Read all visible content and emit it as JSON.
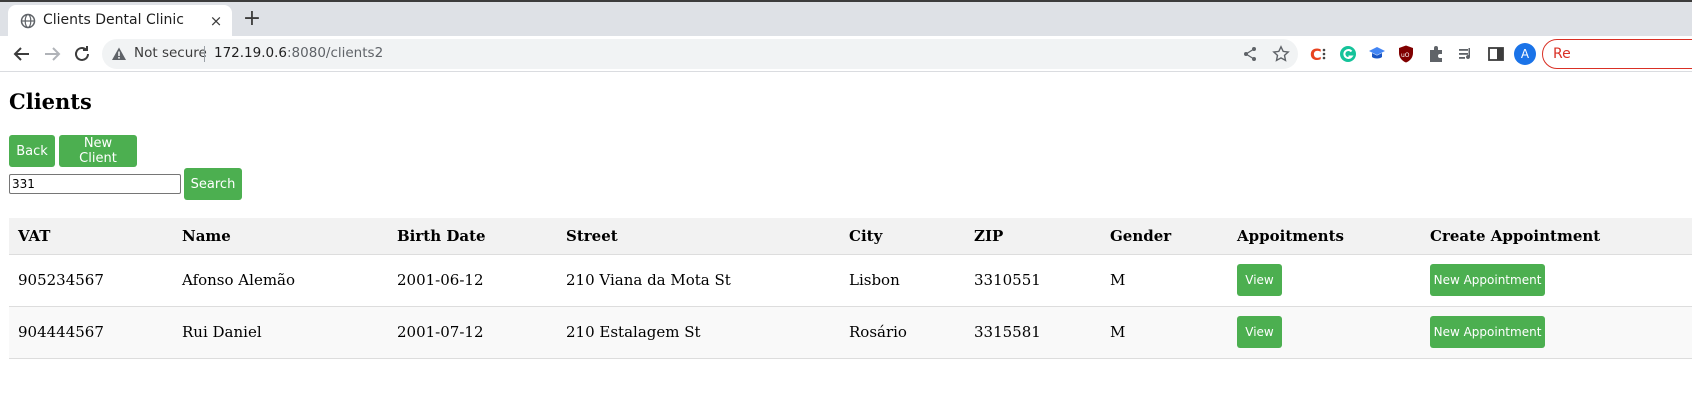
{
  "browser": {
    "tab_title": "Clients Dental Clinic",
    "tab_close": "×",
    "new_tab": "+",
    "not_secure": "Not secure",
    "url_host": "172.19.0.6",
    "url_rest": ":8080/clients2",
    "profile_initial": "A",
    "relaunch_label": "Re"
  },
  "page": {
    "title": "Clients",
    "back_label": "Back",
    "new_client_label": "New Client",
    "search_value": "331",
    "search_label": "Search"
  },
  "table": {
    "headers": [
      "VAT",
      "Name",
      "Birth Date",
      "Street",
      "City",
      "ZIP",
      "Gender",
      "Appoitments",
      "Create Appointment"
    ],
    "rows": [
      {
        "vat": "905234567",
        "name": "Afonso Alemão",
        "birth_date": "2001-06-12",
        "street": "210 Viana da Mota St",
        "city": "Lisbon",
        "zip": "3310551",
        "gender": "M",
        "view_label": "View",
        "new_appointment_label": "New Appointment"
      },
      {
        "vat": "904444567",
        "name": "Rui Daniel",
        "birth_date": "2001-07-12",
        "street": "210 Estalagem St",
        "city": "Rosário",
        "zip": "3315581",
        "gender": "M",
        "view_label": "View",
        "new_appointment_label": "New Appointment"
      }
    ]
  },
  "colors": {
    "accent": "#4caf50",
    "header_bg": "#f2f2f2"
  }
}
